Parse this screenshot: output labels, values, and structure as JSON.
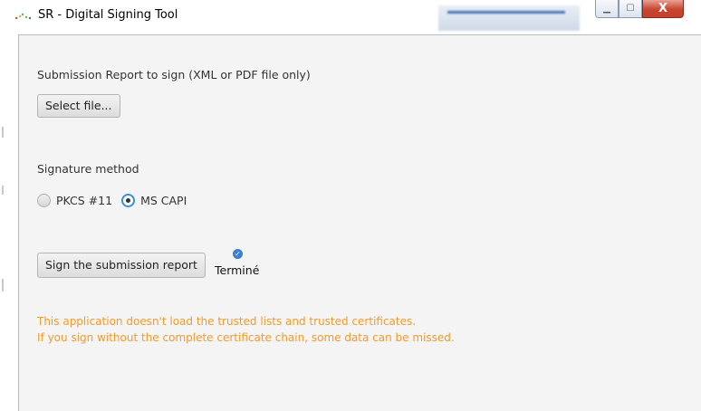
{
  "window": {
    "title": "SR - Digital Signing Tool",
    "controls": {
      "minimize_icon": "minimize-icon",
      "maximize_icon": "maximize-icon",
      "close_label": "X"
    }
  },
  "form": {
    "file_section_label": "Submission Report to sign (XML or PDF file only)",
    "select_file_button": "Select file...",
    "signature_method_label": "Signature method",
    "methods": [
      {
        "label": "PKCS #11",
        "selected": false
      },
      {
        "label": "MS CAPI",
        "selected": true
      }
    ],
    "sign_button": "Sign the submission report",
    "status_text": "Terminé",
    "warning_lines": [
      "This application doesn't load the trusted lists and trusted certificates.",
      "If you sign without the complete certificate chain, some data can be missed."
    ]
  },
  "colors": {
    "warning": "#f39a28",
    "radio_accent": "#3c8fd9",
    "close_button": "#c8462f"
  }
}
